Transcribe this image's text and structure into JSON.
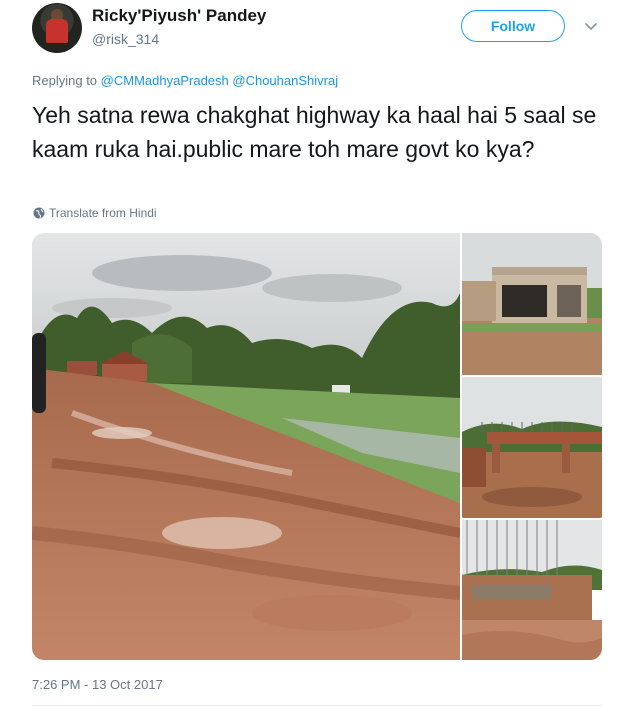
{
  "user": {
    "display_name": "Ricky'Piyush' Pandey",
    "handle": "@risk_314"
  },
  "follow_button": {
    "label": "Follow"
  },
  "reply": {
    "prefix": "Replying to",
    "mentions": [
      "@CMMadhyaPradesh",
      "@ChouhanShivraj"
    ]
  },
  "tweet": {
    "text": "Yeh satna rewa chakghat highway ka haal hai 5 saal se kaam ruka hai.public mare toh mare govt ko kya?"
  },
  "translate": {
    "label": "Translate from Hindi",
    "icon": "globe-icon"
  },
  "media": [
    {
      "name": "muddy-road-photo"
    },
    {
      "name": "unfinished-bridge-photo-1"
    },
    {
      "name": "unfinished-bridge-photo-2"
    },
    {
      "name": "unfinished-bridge-photo-3"
    }
  ],
  "timestamp": "7:26 PM - 13 Oct 2017",
  "colors": {
    "accent": "#1da1f2",
    "link": "#1b95e0",
    "muted": "#657786",
    "text": "#14171a"
  }
}
